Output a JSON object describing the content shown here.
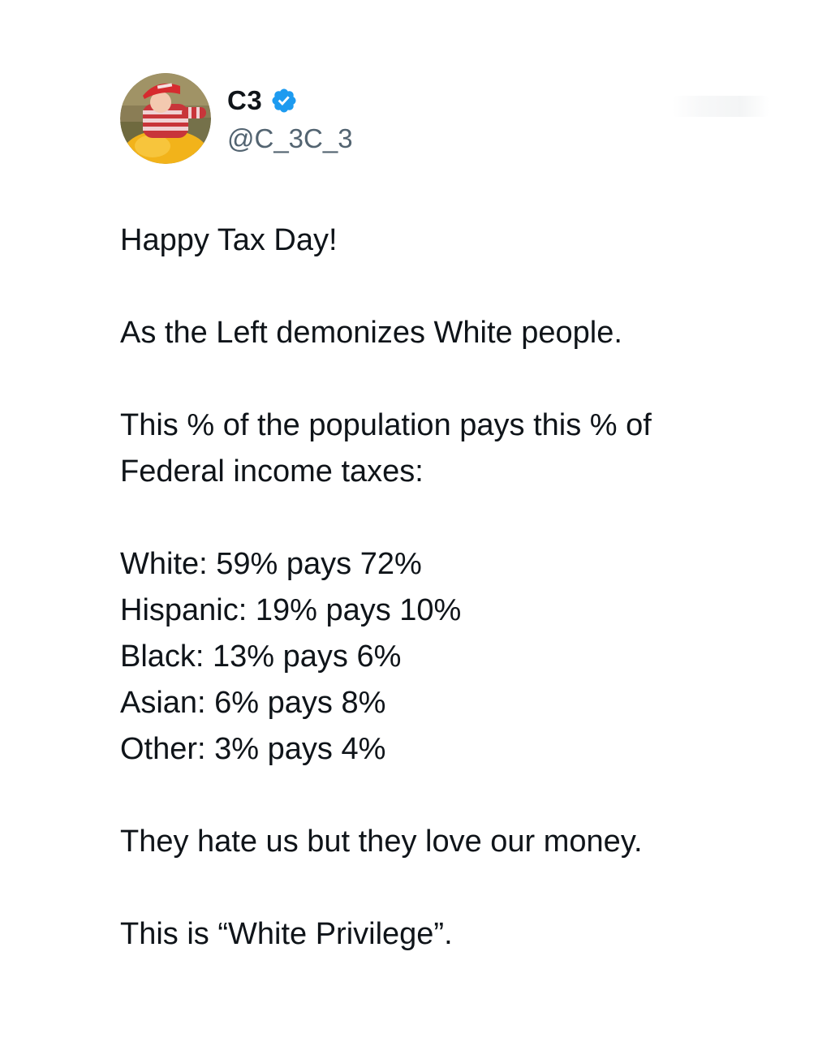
{
  "author": {
    "display_name": "C3",
    "handle": "@C_3C_3",
    "verified": true,
    "avatar_icon": "avatar-photo",
    "verified_color": "#1d9bf0"
  },
  "post": {
    "greeting": "Happy Tax Day!",
    "line_left": "As the Left demonizes White people.",
    "intro_line1": "This % of the population pays this % of",
    "intro_line2": "Federal income taxes:",
    "stats": [
      "White: 59% pays 72%",
      "Hispanic: 19% pays 10%",
      "Black: 13% pays 6%",
      "Asian: 6% pays 8%",
      "Other: 3% pays 4%"
    ],
    "closing": "They hate us but they love our money.",
    "final": "This is “White Privilege”."
  }
}
